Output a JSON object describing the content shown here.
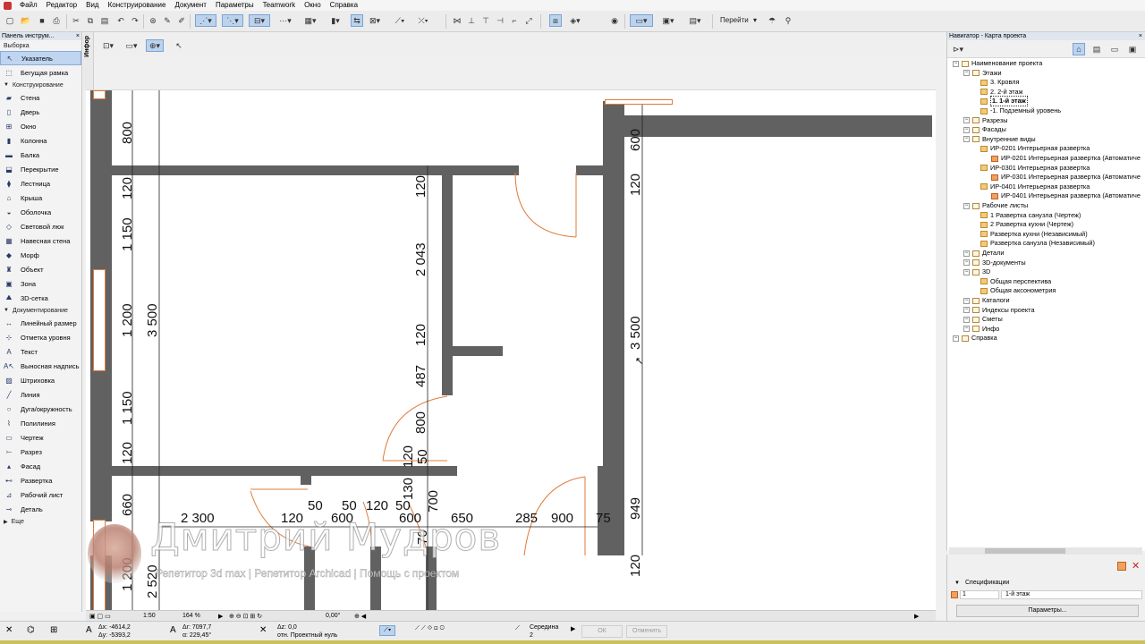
{
  "menu": [
    "Файл",
    "Редактор",
    "Вид",
    "Конструирование",
    "Документ",
    "Параметры",
    "Teamwork",
    "Окно",
    "Справка"
  ],
  "toolbar": {
    "goto_label": "Перейти"
  },
  "palette": {
    "title": "Панель инструм...",
    "selection_header": "Выборка",
    "pointer": "Указатель",
    "marquee": "Бегущая рамка",
    "construction_header": "Конструирование",
    "construction": [
      "Стена",
      "Дверь",
      "Окно",
      "Колонна",
      "Балка",
      "Перекрытие",
      "Лестница",
      "Крыша",
      "Оболочка",
      "Световой люк",
      "Навесная стена",
      "Морф",
      "Объект",
      "Зона",
      "3D-сетка"
    ],
    "documentation_header": "Документирование",
    "documentation": [
      "Линейный размер",
      "Отметка уровня",
      "Текст",
      "Выносная надпись",
      "Штриховка",
      "Линия",
      "Дуга/окружность",
      "Полилиния",
      "Чертеж",
      "Разрез",
      "Фасад",
      "Развертка",
      "Рабочий лист",
      "Деталь"
    ],
    "more": "Еще"
  },
  "info_tab": "Инфор",
  "drawing": {
    "dims": {
      "d800": "800",
      "d120a": "120",
      "d1150a": "1 150",
      "d1200": "1 200",
      "d3500": "3 500",
      "d1150b": "1 150",
      "d120b": "120",
      "d660": "660",
      "d1200b": "1 200",
      "d2520": "2 520",
      "d120c": "120",
      "d2043": "2 043",
      "d120d": "120",
      "d487": "487",
      "d800b": "800",
      "d120e": "120",
      "d50v": "50",
      "d130": "130",
      "d700": "700",
      "d70": "70",
      "d600r": "600",
      "d120r": "120",
      "d3500r": "3 500",
      "d949": "949",
      "d120r2": "120",
      "h2300": "2 300",
      "h120": "120",
      "h50a": "50",
      "h600a": "600",
      "h50b": "50",
      "h120b": "120",
      "h50c": "50",
      "h600b": "600",
      "h650": "650",
      "h285": "285",
      "h900": "900",
      "h75": "75"
    }
  },
  "canvas_status": {
    "scale": "1:50",
    "zoom": "164 %",
    "angle": "0,00°"
  },
  "coords": {
    "dx": "Δx: -4614,2",
    "dy": "Δy: -5393,2",
    "dr": "Δr: 7097,7",
    "da": "α: 229,45°",
    "dz": "Δz: 0,0",
    "ref": "отн. Проектный нуль",
    "snap": "Середина",
    "snap_n": "2",
    "ok": "ОК",
    "cancel": "Отменить"
  },
  "navigator": {
    "title": "Навигатор - Карта проекта",
    "tree": [
      {
        "label": "Наименование проекта",
        "depth": 0
      },
      {
        "label": "Этажи",
        "depth": 1
      },
      {
        "label": "3. Кровля",
        "depth": 2
      },
      {
        "label": "2. 2-й этаж",
        "depth": 2
      },
      {
        "label": "1. 1-й этаж",
        "depth": 2
      },
      {
        "label": "-1. Подземный уровень",
        "depth": 2
      },
      {
        "label": "Разрезы",
        "depth": 1
      },
      {
        "label": "Фасады",
        "depth": 1
      },
      {
        "label": "Внутренние виды",
        "depth": 1
      },
      {
        "label": "ИР-0201 Интерьерная развертка",
        "depth": 2
      },
      {
        "label": "ИР-0201 Интерьерная развертка (Автоматиче",
        "depth": 3
      },
      {
        "label": "ИР-0301 Интерьерная развертка",
        "depth": 2
      },
      {
        "label": "ИР-0301 Интерьерная развертка (Автоматиче",
        "depth": 3
      },
      {
        "label": "ИР-0401 Интерьерная развертка",
        "depth": 2
      },
      {
        "label": "ИР-0401 Интерьерная развертка (Автоматиче",
        "depth": 3
      },
      {
        "label": "Рабочие листы",
        "depth": 1
      },
      {
        "label": "1 Развертка санузла (Чертеж)",
        "depth": 2
      },
      {
        "label": "2 Развертка кухни (Чертеж)",
        "depth": 2
      },
      {
        "label": "Развертка кухни (Независимый)",
        "depth": 2
      },
      {
        "label": "Развертка санузла (Независимый)",
        "depth": 2
      },
      {
        "label": "Детали",
        "depth": 1
      },
      {
        "label": "3D-документы",
        "depth": 1
      },
      {
        "label": "3D",
        "depth": 1
      },
      {
        "label": "Общая перспектива",
        "depth": 2
      },
      {
        "label": "Общая аксонометрия",
        "depth": 2
      },
      {
        "label": "Каталоги",
        "depth": 1
      },
      {
        "label": "Индексы проекта",
        "depth": 1
      },
      {
        "label": "Сметы",
        "depth": 1
      },
      {
        "label": "Инфо",
        "depth": 1
      },
      {
        "label": "Справка",
        "depth": 0
      }
    ],
    "spec_label": "Спецификации",
    "spec_id": "1",
    "spec_name": "1-й этаж",
    "params_button": "Параметры..."
  },
  "watermark": {
    "name": "Дмитрий Мудров",
    "subtitle": "Репетитор 3d max | Репетитор Archicad | Помощь с проектом"
  },
  "colors": {
    "wall": "#616161",
    "door_window": "#e07b39",
    "selection": "#bfd5f0",
    "stripe": "#c9c05a"
  }
}
